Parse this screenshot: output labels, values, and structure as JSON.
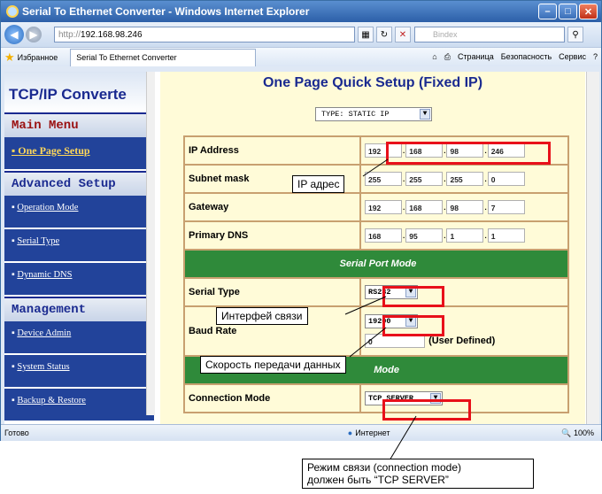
{
  "window": {
    "title": "Serial To Ethernet Converter - Windows Internet Explorer"
  },
  "browser": {
    "url_proto": "http://",
    "url_host": "192.168.98.246",
    "search_placeholder": "Bindex",
    "favorites_label": "Избранное",
    "tab_label": "Serial To Ethernet Converter",
    "cmd_page": "Страница",
    "cmd_safety": "Безопасность",
    "cmd_service": "Сервис"
  },
  "sidebar": {
    "brand": "TCP/IP Converte",
    "main_menu": "Main Menu",
    "one_page_setup": "One Page Setup",
    "advanced_setup": "Advanced Setup",
    "items": [
      "Operation Mode",
      "Serial Type",
      "Dynamic DNS"
    ],
    "management": "Management",
    "mgmt_items": [
      "Device Admin",
      "System Status",
      "Backup & Restore"
    ]
  },
  "main": {
    "title": "One Page Quick Setup (Fixed IP)",
    "type_select": "TYPE: STATIC IP",
    "ip_label": "IP Address",
    "ip": [
      "192",
      "168",
      "98",
      "246"
    ],
    "subnet_label": "Subnet mask",
    "subnet": [
      "255",
      "255",
      "255",
      "0"
    ],
    "gateway_label": "Gateway",
    "gateway": [
      "192",
      "168",
      "98",
      "7"
    ],
    "dns_label": "Primary DNS",
    "dns": [
      "168",
      "95",
      "1",
      "1"
    ],
    "serial_port_mode": "Serial Port Mode",
    "serial_type_label": "Serial Type",
    "serial_type": "RS232",
    "baud_label": "Baud Rate",
    "baud": "19200",
    "user_defined_value": "0",
    "user_defined_label": "(User Defined)",
    "network_mode_partial": "Mode",
    "conn_mode_label": "Connection Mode",
    "conn_mode": "TCP SERVER"
  },
  "status": {
    "left": "Готово",
    "zone": "Интернет",
    "zoom": "100%"
  },
  "annotations": {
    "ip": "IP адрес",
    "interface": "Интерфей связи",
    "baud": "Скорость передачи данных",
    "mode_line1": "Режим связи (connection mode)",
    "mode_line2": "должен быть “TCP  SERVER”"
  }
}
